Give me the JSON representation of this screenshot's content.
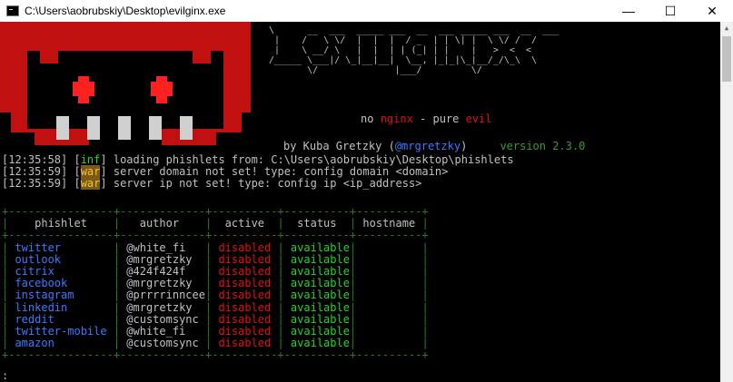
{
  "window": {
    "title": "C:\\Users\\aobrubskiy\\Desktop\\evilginx.exe",
    "minimize": "—",
    "maximize": "☐",
    "close": "✕"
  },
  "banner": {
    "tagline_no": "no ",
    "tagline_nginx": "nginx",
    "tagline_sep": " - pure ",
    "tagline_evil": "evil",
    "by_prefix": "by Kuba Gretzky (",
    "by_handle": "@mrgretzky",
    "by_suffix": ")",
    "version_label": "version 2.3.0"
  },
  "log": [
    {
      "time": "[12:35:58]",
      "tag": "inf",
      "text": " loading phishlets from: C:\\Users\\aobrubskiy\\Desktop\\phishlets"
    },
    {
      "time": "[12:35:59]",
      "tag": "war",
      "text": " server domain not set! type: config domain <domain>"
    },
    {
      "time": "[12:35:59]",
      "tag": "war",
      "text": " server ip not set! type: config ip <ip_address>"
    }
  ],
  "table": {
    "headers": [
      "phishlet",
      "author",
      "active",
      "status",
      "hostname"
    ],
    "rows": [
      {
        "phishlet": "twitter",
        "author": "@white_fi",
        "active": "disabled",
        "status": "available",
        "hostname": ""
      },
      {
        "phishlet": "outlook",
        "author": "@mrgretzky",
        "active": "disabled",
        "status": "available",
        "hostname": ""
      },
      {
        "phishlet": "citrix",
        "author": "@424f424f",
        "active": "disabled",
        "status": "available",
        "hostname": ""
      },
      {
        "phishlet": "facebook",
        "author": "@mrgretzky",
        "active": "disabled",
        "status": "available",
        "hostname": ""
      },
      {
        "phishlet": "instagram",
        "author": "@prrrrinncee",
        "active": "disabled",
        "status": "available",
        "hostname": ""
      },
      {
        "phishlet": "linkedin",
        "author": "@mrgretzky",
        "active": "disabled",
        "status": "available",
        "hostname": ""
      },
      {
        "phishlet": "reddit",
        "author": "@customsync",
        "active": "disabled",
        "status": "available",
        "hostname": ""
      },
      {
        "phishlet": "twitter-mobile",
        "author": "@white_fi",
        "active": "disabled",
        "status": "available",
        "hostname": ""
      },
      {
        "phishlet": "amazon",
        "author": "@customsync",
        "active": "disabled",
        "status": "available",
        "hostname": ""
      }
    ]
  },
  "prompt": ":",
  "colors": {
    "background": "#000000",
    "demon_red": "#c01010",
    "eye_red": "#ff2020",
    "teeth": "#d0d0d0",
    "phishlet_blue": "#3a7bff",
    "disabled_red": "#e01010",
    "available_green": "#26d426"
  }
}
